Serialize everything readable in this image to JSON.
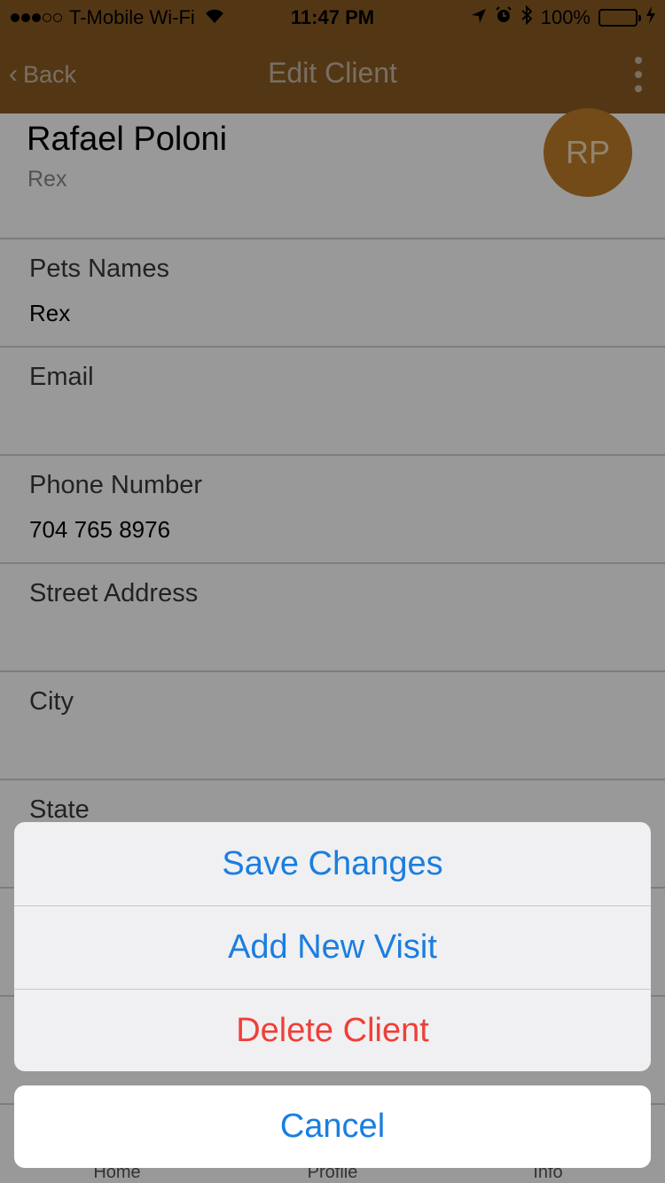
{
  "status_bar": {
    "carrier": "T-Mobile Wi-Fi",
    "time": "11:47 PM",
    "battery_percent": "100%",
    "signal_bars_filled": 3,
    "signal_bars_total": 5
  },
  "nav": {
    "back_label": "Back",
    "title": "Edit Client"
  },
  "client": {
    "name": "Rafael Poloni",
    "pets_subtitle": "Rex",
    "initials": "RP"
  },
  "fields": [
    {
      "label": "Pets Names",
      "value": "Rex"
    },
    {
      "label": "Email",
      "value": ""
    },
    {
      "label": "Phone Number",
      "value": "704 765 8976"
    },
    {
      "label": "Street Address",
      "value": ""
    },
    {
      "label": "City",
      "value": ""
    },
    {
      "label": "State",
      "value": ""
    }
  ],
  "tabs": [
    "Home",
    "Profile",
    "Info"
  ],
  "action_sheet": {
    "actions": [
      {
        "label": "Save Changes",
        "style": "default"
      },
      {
        "label": "Add New Visit",
        "style": "default"
      },
      {
        "label": "Delete Client",
        "style": "destructive"
      }
    ],
    "cancel_label": "Cancel"
  },
  "colors": {
    "brand": "#8b5d24",
    "avatar": "#c07e2a",
    "action_blue": "#1a7ee0",
    "destructive_red": "#ef3f38"
  }
}
